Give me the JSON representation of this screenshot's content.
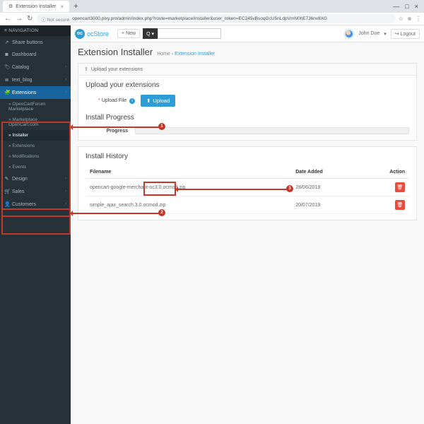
{
  "browser": {
    "tab_title": "Extension Installer",
    "not_secure": "Not secure",
    "url": "opencart3000.pixy.pro/admin/index.php?route=marketplace/installer&user_token=EC245vBsoqGcU5nLdpVmN0hE7J6nv8XG"
  },
  "brand": {
    "logo_text": "oc",
    "name": "ocStore"
  },
  "topbar": {
    "new_btn": "+ New",
    "user_name": "John Doe",
    "logout": "Logout"
  },
  "sidebar": {
    "header": "≡ NAVIGATION",
    "items": [
      {
        "icon": "↗",
        "label": "Share buttons"
      },
      {
        "icon": "◙",
        "label": "Dashboard"
      },
      {
        "icon": "🏷",
        "label": "Catalog",
        "chev": true
      },
      {
        "icon": "≣",
        "label": "text_blog",
        "chev": true
      },
      {
        "icon": "🧩",
        "label": "Extensions",
        "chev": true,
        "active": true
      },
      {
        "icon": "✎",
        "label": "Design",
        "chev": true
      },
      {
        "icon": "🛒",
        "label": "Sales",
        "chev": true
      },
      {
        "icon": "👤",
        "label": "Customers",
        "chev": true
      }
    ],
    "subs": [
      {
        "label": "OpenCartForum Marketplace"
      },
      {
        "label": "Marketplace OpenCart.com"
      },
      {
        "label": "Installer",
        "active": true
      },
      {
        "label": "Extensions"
      },
      {
        "label": "Modifications"
      },
      {
        "label": "Events"
      }
    ]
  },
  "page": {
    "title": "Extension Installer",
    "crumb_home": "Home",
    "crumb_current": "Extension Installer"
  },
  "upload_panel": {
    "head": "Upload your extensions",
    "section": "Upload your extensions",
    "label": "Upload File",
    "required_mark": "*",
    "button": "Upload"
  },
  "progress_panel": {
    "section": "Install Progress",
    "label": "Progress"
  },
  "history_panel": {
    "section": "Install History",
    "cols": {
      "filename": "Filename",
      "date": "Date Added",
      "action": "Action"
    },
    "rows": [
      {
        "filename": "opencart-google-merchant-oc3.0.ocmod.zip",
        "date": "28/06/2019"
      },
      {
        "filename": "simple_ajax_search.3.0.ocmod.zip",
        "date": "20/07/2019"
      }
    ]
  },
  "annotations": {
    "n1": "1",
    "n2": "2",
    "n3": "3"
  }
}
